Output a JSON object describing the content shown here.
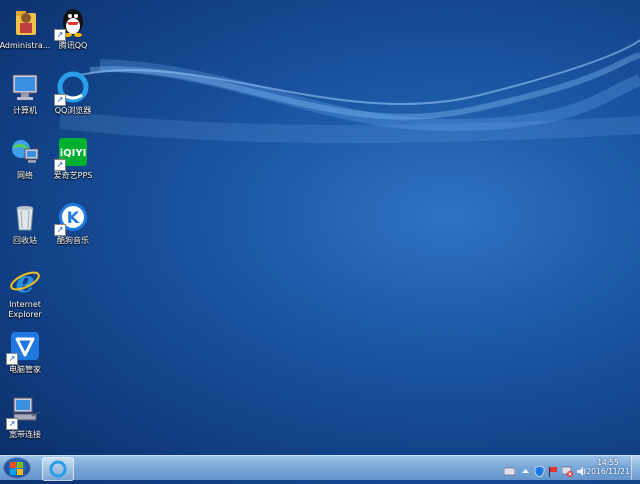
{
  "desktop": {
    "icons": [
      {
        "label": "Administra...",
        "icon": "user-folder-icon"
      },
      {
        "label": "腾讯QQ",
        "icon": "qq-penguin-icon"
      },
      {
        "label": "计算机",
        "icon": "computer-icon"
      },
      {
        "label": "QQ浏览器",
        "icon": "qq-browser-icon"
      },
      {
        "label": "网络",
        "icon": "network-icon"
      },
      {
        "label": "爱奇艺PPS",
        "icon": "iqiyi-icon"
      },
      {
        "label": "回收站",
        "icon": "recycle-bin-icon"
      },
      {
        "label": "酷狗音乐",
        "icon": "kugou-icon"
      },
      {
        "label": "Internet Explorer",
        "icon": "ie-icon"
      },
      {
        "label": "电脑管家",
        "icon": "pc-manager-icon"
      },
      {
        "label": "宽带连接",
        "icon": "broadband-icon"
      }
    ]
  },
  "taskbar": {
    "start": "windows-start-icon",
    "pinned": "qq-browser-icon",
    "clock": {
      "time": "14:55",
      "date": "2016/11/21"
    }
  },
  "colors": {
    "accent": "#1b57a3",
    "taskbar": "#7aa8d8"
  }
}
